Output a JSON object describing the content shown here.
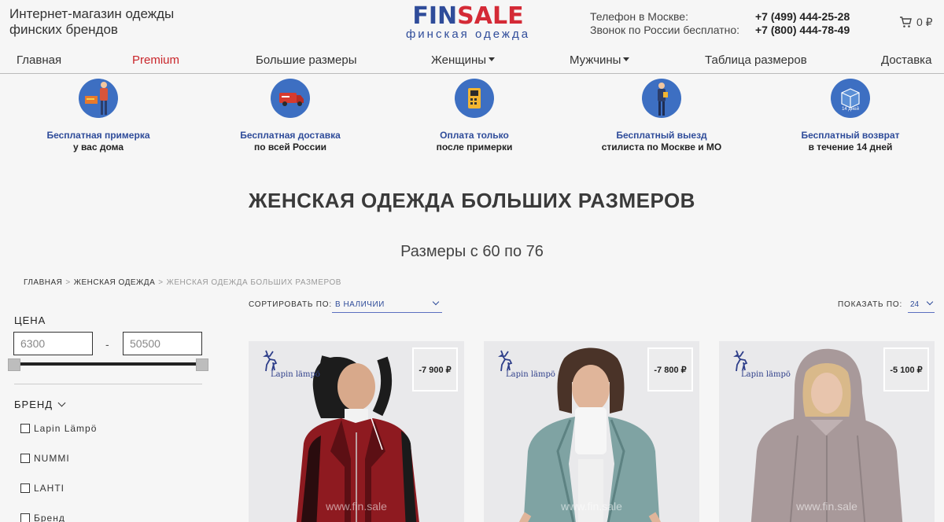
{
  "header": {
    "tagline_line1": "Интернет-магазин одежды",
    "tagline_line2": "финских брендов",
    "logo_fin": "FIN",
    "logo_sale": "SALE",
    "logo_sub": "финская одежда",
    "contacts": [
      {
        "label": "Телефон в Москве:",
        "phone": "+7 (499) 444-25-28"
      },
      {
        "label": "Звонок по России бесплатно:",
        "phone": "+7 (800) 444-78-49"
      }
    ],
    "cart_amount": "0 ₽"
  },
  "nav": [
    {
      "label": "Главная"
    },
    {
      "label": "Premium"
    },
    {
      "label": "Большие размеры"
    },
    {
      "label": "Женщины"
    },
    {
      "label": "Мужчины"
    },
    {
      "label": "Таблица размеров"
    },
    {
      "label": "Доставка"
    }
  ],
  "features": [
    {
      "title": "Бесплатная примерка",
      "sub": "у вас дома",
      "icon": "courier-icon"
    },
    {
      "title": "Бесплатная доставка",
      "sub": "по всей России",
      "icon": "delivery-truck-icon"
    },
    {
      "title": "Оплата только",
      "sub": "после примерки",
      "icon": "payment-terminal-icon"
    },
    {
      "title": "Бесплатный выезд",
      "sub": "стилиста по Москве и МО",
      "icon": "stylist-icon"
    },
    {
      "title": "Бесплатный возврат",
      "sub": "в течение 14 дней",
      "icon": "return-box-icon",
      "badge": "14 дней"
    }
  ],
  "page": {
    "title": "ЖЕНСКАЯ ОДЕЖДА БОЛЬШИХ РАЗМЕРОВ",
    "subtitle": "Размеры с 60 по 76"
  },
  "breadcrumb": {
    "items": [
      "ГЛАВНАЯ",
      "ЖЕНСКАЯ ОДЕЖДА",
      "ЖЕНСКАЯ ОДЕЖДА БОЛЬШИХ РАЗМЕРОВ"
    ],
    "separator": ">"
  },
  "filters": {
    "price_label": "ЦЕНА",
    "price_min": "6300",
    "price_max": "50500",
    "price_dash": "-",
    "brand_label": "БРЕНД",
    "brands": [
      "Lapin Lämpö",
      "NUMMI",
      "LAHTI",
      "Бренд"
    ]
  },
  "sort": {
    "label": "СОРТИРОВАТЬ ПО:",
    "value": "В НАЛИЧИИ",
    "show_label": "ПОКАЗАТЬ ПО:",
    "show_value": "24"
  },
  "products": [
    {
      "brand": "Lapin lämpö",
      "discount": "-7 900 ₽",
      "watermark": "www.fin.sale",
      "jacket_color": "#8e1a20",
      "accent": "#1a1a1a"
    },
    {
      "brand": "Lapin lämpö",
      "discount": "-7 800 ₽",
      "watermark": "www.fin.sale",
      "jacket_color": "#7fa3a3",
      "accent": "#6b8f8f"
    },
    {
      "brand": "Lapin lämpö",
      "discount": "-5 100 ₽",
      "watermark": "www.fin.sale",
      "jacket_color": "#a8999a",
      "accent": "#8f8283"
    }
  ],
  "colors": {
    "brand_blue": "#2f4c9a",
    "brand_red": "#d42a36",
    "premium_red": "#c9262b",
    "feature_icon_bg": "#3d6fc2"
  }
}
